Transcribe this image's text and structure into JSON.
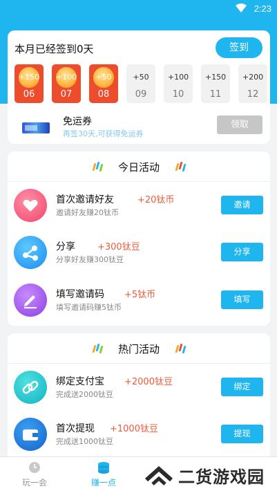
{
  "status_bar": {
    "time": "2:23"
  },
  "checkin": {
    "title": "本月已经签到0天",
    "sign_button": "签到",
    "days": [
      {
        "reward": "+150",
        "day": "06",
        "checked": true
      },
      {
        "reward": "+100",
        "day": "07",
        "checked": true
      },
      {
        "reward": "+50",
        "day": "08",
        "checked": true
      },
      {
        "reward": "+50",
        "day": "09",
        "checked": false
      },
      {
        "reward": "+100",
        "day": "10",
        "checked": false
      },
      {
        "reward": "+150",
        "day": "11",
        "checked": false
      },
      {
        "reward": "+200",
        "day": "12",
        "checked": false
      }
    ],
    "ticket": {
      "title": "免运券",
      "subtitle": "再签30天,可获得免运券",
      "button": "领取"
    }
  },
  "today": {
    "heading": "今日活动",
    "items": [
      {
        "name": "首次邀请好友",
        "reward": "+20钛币",
        "desc": "邀请好友赚20钛币",
        "button": "邀请",
        "icon": "heart-icon"
      },
      {
        "name": "分享",
        "reward": "+300钛豆",
        "desc": "分享好友赚300钛豆",
        "button": "分享",
        "icon": "share-icon"
      },
      {
        "name": "填写邀请码",
        "reward": "+5钛币",
        "desc": "填写邀请码赚5钛币",
        "button": "填写",
        "icon": "pencil-icon"
      }
    ]
  },
  "hot": {
    "heading": "热门活动",
    "items": [
      {
        "name": "绑定支付宝",
        "reward": "+2000钛豆",
        "desc": "完成送2000钛豆",
        "button": "绑定",
        "icon": "link-icon"
      },
      {
        "name": "首次提现",
        "reward": "+1000钛豆",
        "desc": "完成送1000钛豆",
        "button": "提现",
        "icon": "wallet-icon"
      }
    ]
  },
  "tabs": [
    {
      "label": "玩一会",
      "active": false
    },
    {
      "label": "赚一点",
      "active": true
    }
  ],
  "watermark": {
    "text": "二货游戏园"
  },
  "colors": {
    "accent": "#1fb6ef",
    "checked": "#ee4d2d",
    "reward": "#ee5a3a"
  }
}
